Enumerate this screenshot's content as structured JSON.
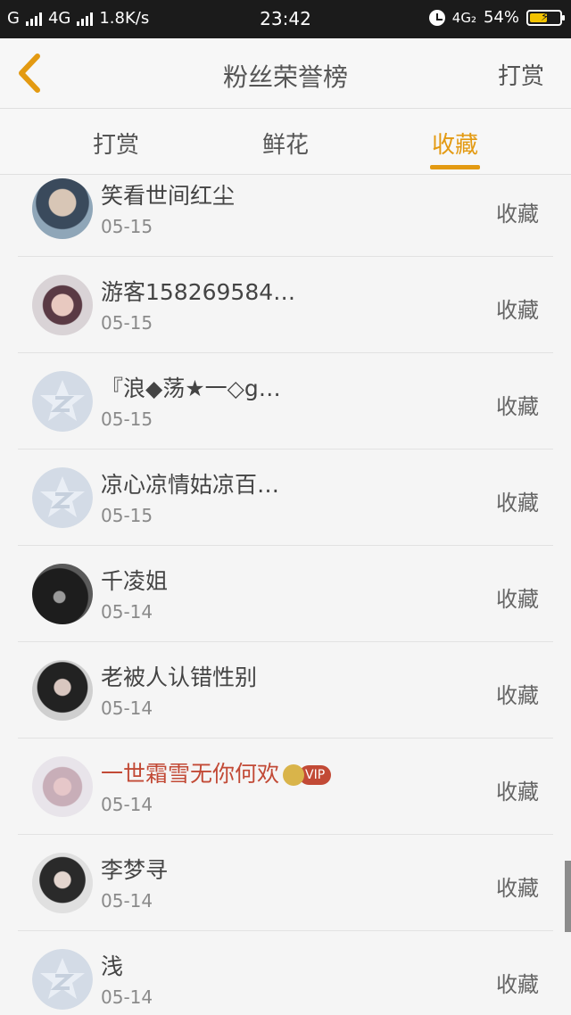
{
  "status_bar": {
    "carrier": "G",
    "network": "4G",
    "speed": "1.8K/s",
    "time": "23:42",
    "network2": "4G₂",
    "battery": "54%"
  },
  "nav": {
    "title": "粉丝荣誉榜",
    "right_action": "打赏"
  },
  "tabs": [
    {
      "label": "打赏",
      "active": false
    },
    {
      "label": "鲜花",
      "active": false
    },
    {
      "label": "收藏",
      "active": true
    }
  ],
  "list": [
    {
      "name": "笑看世间红尘",
      "date": "05-15",
      "action": "收藏",
      "avatar": "photo-boy"
    },
    {
      "name": "游客158269584…",
      "date": "05-15",
      "action": "收藏",
      "avatar": "photo-anime"
    },
    {
      "name": "『浪◆荡★一◇g…",
      "date": "05-15",
      "action": "收藏",
      "avatar": "default-star"
    },
    {
      "name": "凉心凉情姑凉百…",
      "date": "05-15",
      "action": "收藏",
      "avatar": "default-star"
    },
    {
      "name": "千凌姐",
      "date": "05-14",
      "action": "收藏",
      "avatar": "photo-dark"
    },
    {
      "name": "老被人认错性别",
      "date": "05-14",
      "action": "收藏",
      "avatar": "photo-girl"
    },
    {
      "name": "一世霜雪无你何欢",
      "date": "05-14",
      "action": "收藏",
      "avatar": "photo-couple",
      "vip": true,
      "vip_label": "VIP"
    },
    {
      "name": "李梦寻",
      "date": "05-14",
      "action": "收藏",
      "avatar": "photo-girl2"
    },
    {
      "name": "浅",
      "date": "05-14",
      "action": "收藏",
      "avatar": "default-star"
    }
  ],
  "colors": {
    "accent": "#e39a12",
    "vip_name": "#c24a36",
    "status_bar_bg": "#1b1b1b"
  }
}
